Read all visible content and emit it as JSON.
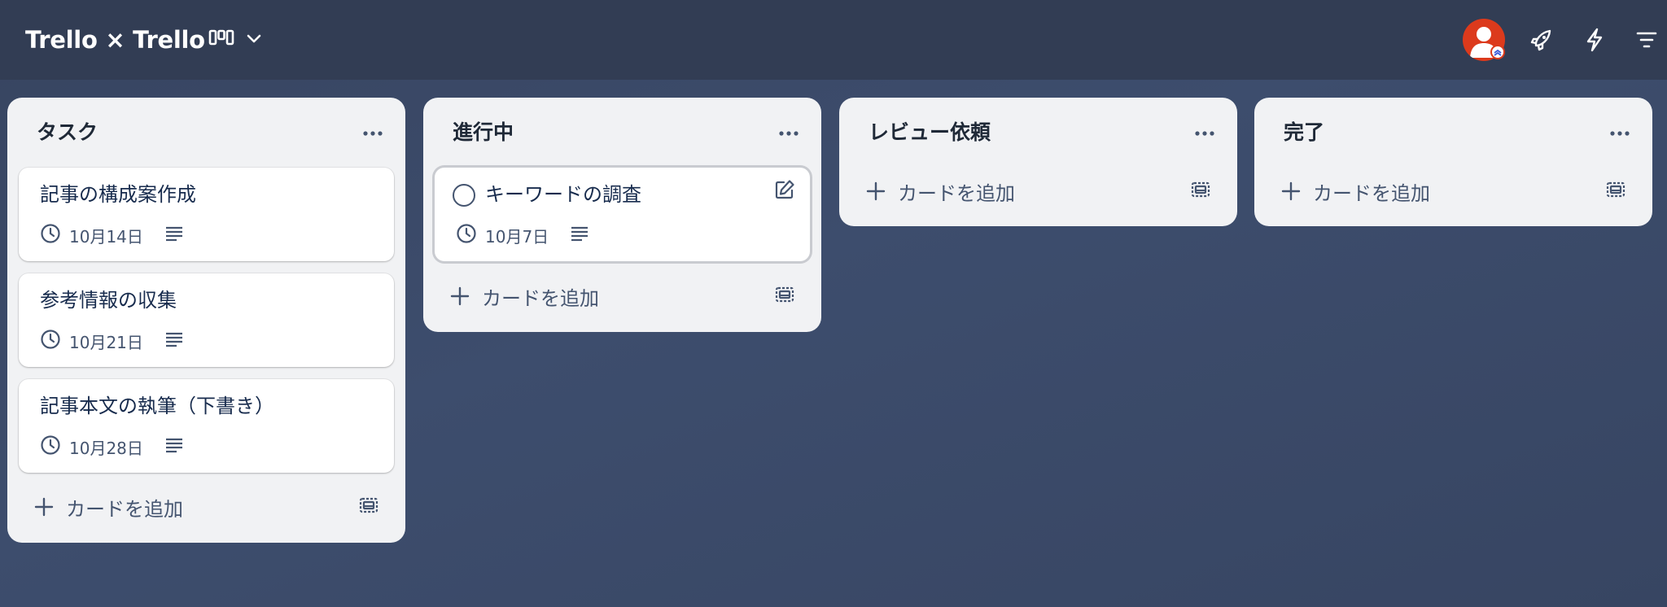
{
  "board": {
    "title": "Trello × Trello"
  },
  "header_icons": {
    "view_switcher": "board-view-icon",
    "view_dropdown": "chevron-down-icon",
    "avatar": "user-avatar",
    "power_ups": "rocket-icon",
    "automation": "lightning-icon",
    "filter": "filter-icon"
  },
  "colors": {
    "header_bg": "#323d54",
    "board_bg": "#3d4d6d",
    "list_bg": "#f1f2f4",
    "avatar": "#dc3a1c"
  },
  "lists": [
    {
      "title": "タスク",
      "cards": [
        {
          "title": "記事の構成案作成",
          "date": "10月14日"
        },
        {
          "title": "参考情報の収集",
          "date": "10月21日"
        },
        {
          "title": "記事本文の執筆（下書き）",
          "date": "10月28日"
        }
      ],
      "add_label": "カードを追加"
    },
    {
      "title": "進行中",
      "cards": [
        {
          "title": "キーワードの調査",
          "date": "10月7日"
        }
      ],
      "add_label": "カードを追加"
    },
    {
      "title": "レビュー依頼",
      "cards": [],
      "add_label": "カードを追加"
    },
    {
      "title": "完了",
      "cards": [],
      "add_label": "カードを追加"
    }
  ]
}
